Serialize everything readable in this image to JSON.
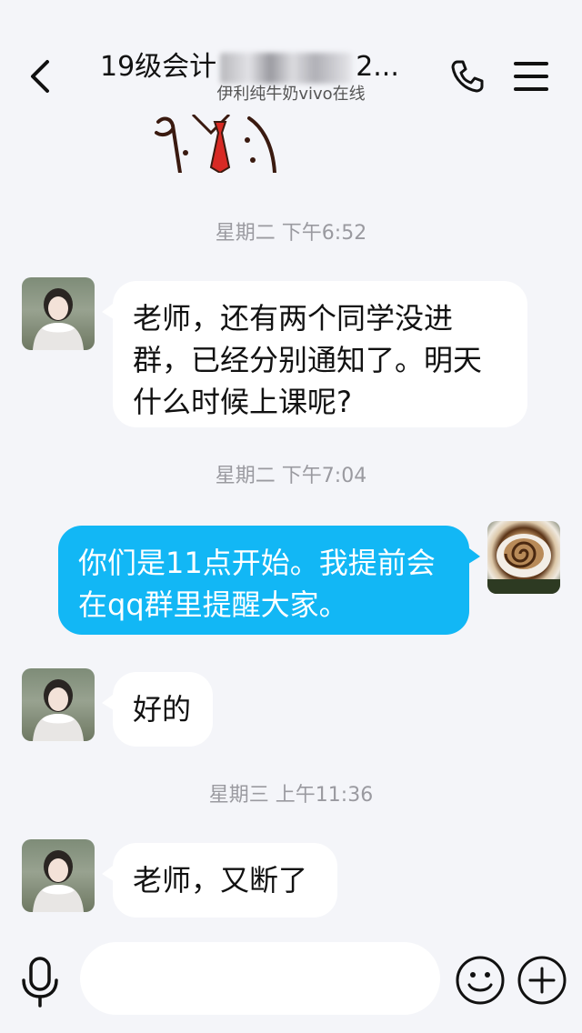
{
  "header": {
    "title_visible": "19级会计",
    "title_tail": "2...",
    "subtitle": "伊利纯牛奶vivo在线"
  },
  "icons": {
    "back": "chevron-left-icon",
    "phone": "phone-icon",
    "menu": "hamburger-menu-icon",
    "mic": "microphone-icon",
    "emoji": "smiley-icon",
    "plus": "plus-circle-icon"
  },
  "messages": [
    {
      "type": "timestamp",
      "text": "星期二 下午6:52"
    },
    {
      "type": "incoming",
      "text_line1": "老师，还有两个同学没进",
      "text_line2": "群，已经分别通知了。明天",
      "text_line3": "什么时候上课呢?"
    },
    {
      "type": "timestamp",
      "text": "星期二 下午7:04"
    },
    {
      "type": "outgoing",
      "text_line1": "你们是11点开始。我提前会",
      "text_line2": "在qq群里提醒大家。"
    },
    {
      "type": "incoming",
      "text_line1": "好的"
    },
    {
      "type": "timestamp",
      "text": "星期三 上午11:36"
    },
    {
      "type": "incoming",
      "text_line1": "老师，又断了"
    }
  ],
  "input": {
    "value": "",
    "placeholder": ""
  },
  "colors": {
    "background": "#f4f5f9",
    "outgoing_bubble": "#12b7f5",
    "incoming_bubble": "#ffffff",
    "timestamp": "#9a9aa0",
    "icon": "#111111"
  }
}
